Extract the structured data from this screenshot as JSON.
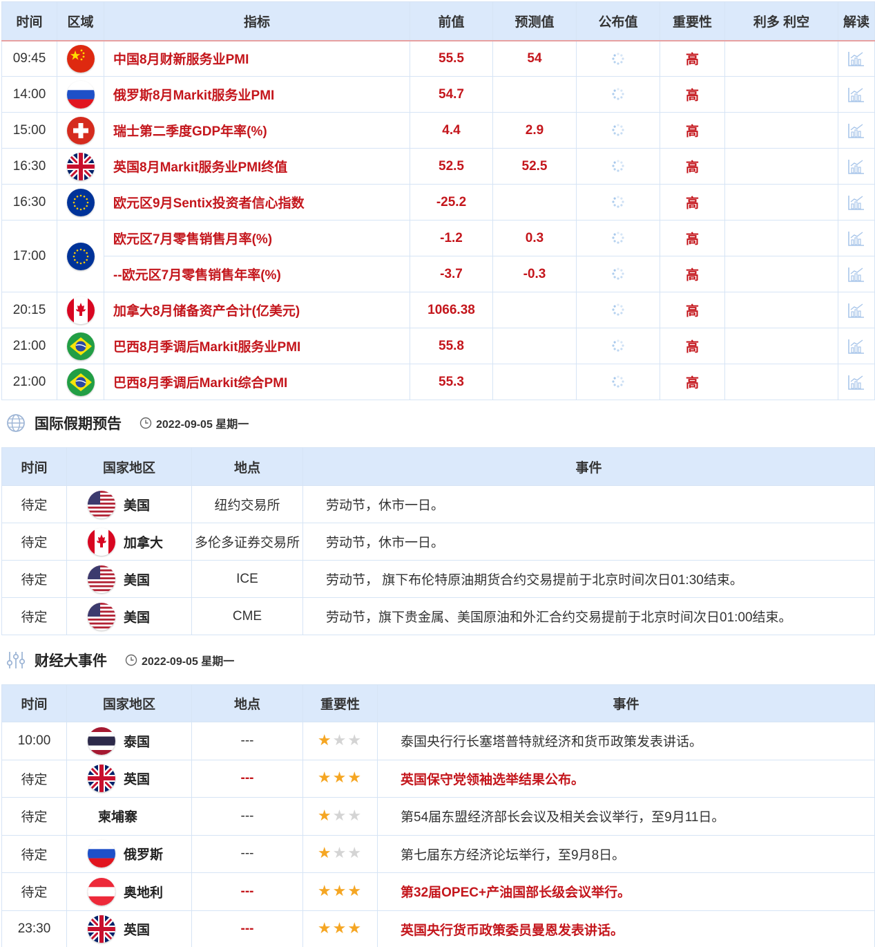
{
  "calendar": {
    "headers": [
      "时间",
      "区域",
      "指标",
      "前值",
      "预测值",
      "公布值",
      "重要性",
      "利多 利空",
      "解读"
    ],
    "rows": [
      {
        "time": "09:45",
        "flag": "cn",
        "indicator": "中国8月财新服务业PMI",
        "prev": "55.5",
        "forecast": "54",
        "importance": "高"
      },
      {
        "time": "14:00",
        "flag": "ru",
        "indicator": "俄罗斯8月Markit服务业PMI",
        "prev": "54.7",
        "forecast": "",
        "importance": "高"
      },
      {
        "time": "15:00",
        "flag": "ch",
        "indicator": "瑞士第二季度GDP年率(%)",
        "prev": "4.4",
        "forecast": "2.9",
        "importance": "高"
      },
      {
        "time": "16:30",
        "flag": "gb",
        "indicator": "英国8月Markit服务业PMI终值",
        "prev": "52.5",
        "forecast": "52.5",
        "importance": "高"
      },
      {
        "time": "16:30",
        "flag": "eu",
        "indicator": "欧元区9月Sentix投资者信心指数",
        "prev": "-25.2",
        "forecast": "",
        "importance": "高"
      },
      {
        "time": "17:00",
        "flag": "eu",
        "indicator": "欧元区7月零售销售月率(%)",
        "prev": "-1.2",
        "forecast": "0.3",
        "importance": "高"
      },
      {
        "time": "",
        "flag": "",
        "indicator": "--欧元区7月零售销售年率(%)",
        "prev": "-3.7",
        "forecast": "-0.3",
        "importance": "高"
      },
      {
        "time": "20:15",
        "flag": "ca",
        "indicator": "加拿大8月储备资产合计(亿美元)",
        "prev": "1066.38",
        "forecast": "",
        "importance": "高"
      },
      {
        "time": "21:00",
        "flag": "br",
        "indicator": "巴西8月季调后Markit服务业PMI",
        "prev": "55.8",
        "forecast": "",
        "importance": "高"
      },
      {
        "time": "21:00",
        "flag": "br",
        "indicator": "巴西8月季调后Markit综合PMI",
        "prev": "55.3",
        "forecast": "",
        "importance": "高"
      }
    ]
  },
  "holidays": {
    "title": "国际假期预告",
    "date": "2022-09-05 星期一",
    "headers": [
      "时间",
      "国家地区",
      "地点",
      "事件"
    ],
    "rows": [
      {
        "time": "待定",
        "flag": "us",
        "country": "美国",
        "place": "纽约交易所",
        "event": "劳动节，休市一日。"
      },
      {
        "time": "待定",
        "flag": "ca",
        "country": "加拿大",
        "place": "多伦多证券交易所",
        "event": "劳动节，休市一日。"
      },
      {
        "time": "待定",
        "flag": "us",
        "country": "美国",
        "place": "ICE",
        "event": "劳动节， 旗下布伦特原油期货合约交易提前于北京时间次日01:30结束。"
      },
      {
        "time": "待定",
        "flag": "us",
        "country": "美国",
        "place": "CME",
        "event": "劳动节，旗下贵金属、美国原油和外汇合约交易提前于北京时间次日01:00结束。"
      }
    ]
  },
  "events": {
    "title": "财经大事件",
    "date": "2022-09-05 星期一",
    "headers": [
      "时间",
      "国家地区",
      "地点",
      "重要性",
      "事件"
    ],
    "rows": [
      {
        "time": "10:00",
        "flag": "th",
        "country": "泰国",
        "place": "---",
        "stars": 1,
        "event": "泰国央行行长塞塔普特就经济和货币政策发表讲话。",
        "highlight": false
      },
      {
        "time": "待定",
        "flag": "gb",
        "country": "英国",
        "place": "---",
        "stars": 3,
        "event": "英国保守党领袖选举结果公布。",
        "highlight": true
      },
      {
        "time": "待定",
        "flag": "",
        "country": "柬埔寨",
        "place": "---",
        "stars": 1,
        "event": "第54届东盟经济部长会议及相关会议举行，至9月11日。",
        "highlight": false
      },
      {
        "time": "待定",
        "flag": "ru",
        "country": "俄罗斯",
        "place": "---",
        "stars": 1,
        "event": "第七届东方经济论坛举行，至9月8日。",
        "highlight": false
      },
      {
        "time": "待定",
        "flag": "at",
        "country": "奥地利",
        "place": "---",
        "stars": 3,
        "event": "第32届OPEC+产油国部长级会议举行。",
        "highlight": true
      },
      {
        "time": "23:30",
        "flag": "gb",
        "country": "英国",
        "place": "---",
        "stars": 3,
        "event": "英国央行货币政策委员曼恩发表讲话。",
        "highlight": true
      }
    ]
  },
  "colors": {
    "accent_red": "#c4161c",
    "header_bg": "#dbe9fb",
    "border": "#d6e4f5",
    "star_on": "#f5a623",
    "star_off": "#d4d4d4"
  }
}
